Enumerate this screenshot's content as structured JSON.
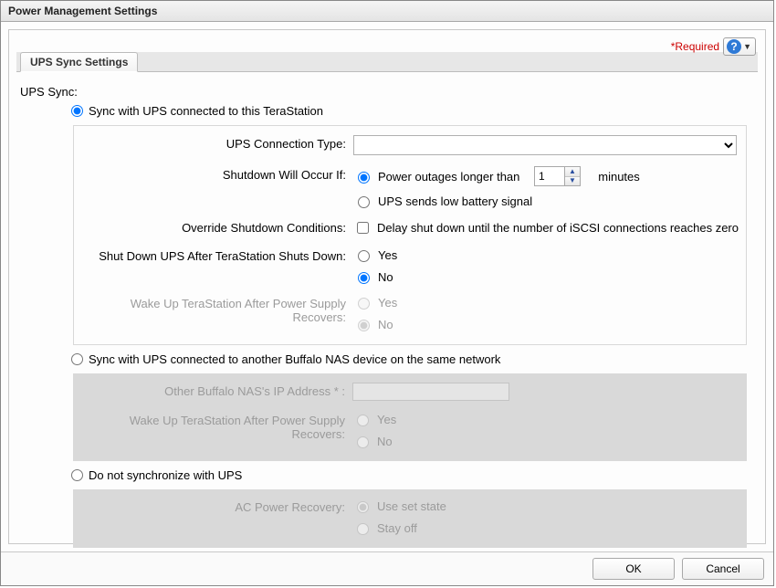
{
  "dialog_title": "Power Management Settings",
  "required_text": "*Required",
  "tab_label": "UPS Sync Settings",
  "section_heading": "UPS Sync:",
  "radio_sync_this": "Sync with UPS connected to this TeraStation",
  "label_connection_type": "UPS Connection Type:",
  "label_shutdown_occur": "Shutdown Will Occur If:",
  "radio_outage_long": "Power outages longer than",
  "minutes_value": "1",
  "minutes_label": "minutes",
  "radio_low_battery": "UPS sends low battery signal",
  "label_override": "Override Shutdown Conditions:",
  "check_override_label": "Delay shut down until the number of iSCSI connections reaches zero",
  "label_shutdown_ups_after": "Shut Down UPS After TeraStation Shuts Down:",
  "yes": "Yes",
  "no": "No",
  "label_wake_after_recover": "Wake Up TeraStation After Power Supply Recovers:",
  "radio_sync_other_nas": "Sync with UPS connected to another Buffalo NAS device on the same network",
  "label_other_nas_ip": "Other Buffalo NAS's IP Address * :",
  "radio_do_not_sync": "Do not synchronize with UPS",
  "label_ac_recovery": "AC Power Recovery:",
  "radio_use_set_state": "Use set state",
  "radio_stay_off": "Stay off",
  "btn_ok": "OK",
  "btn_cancel": "Cancel"
}
